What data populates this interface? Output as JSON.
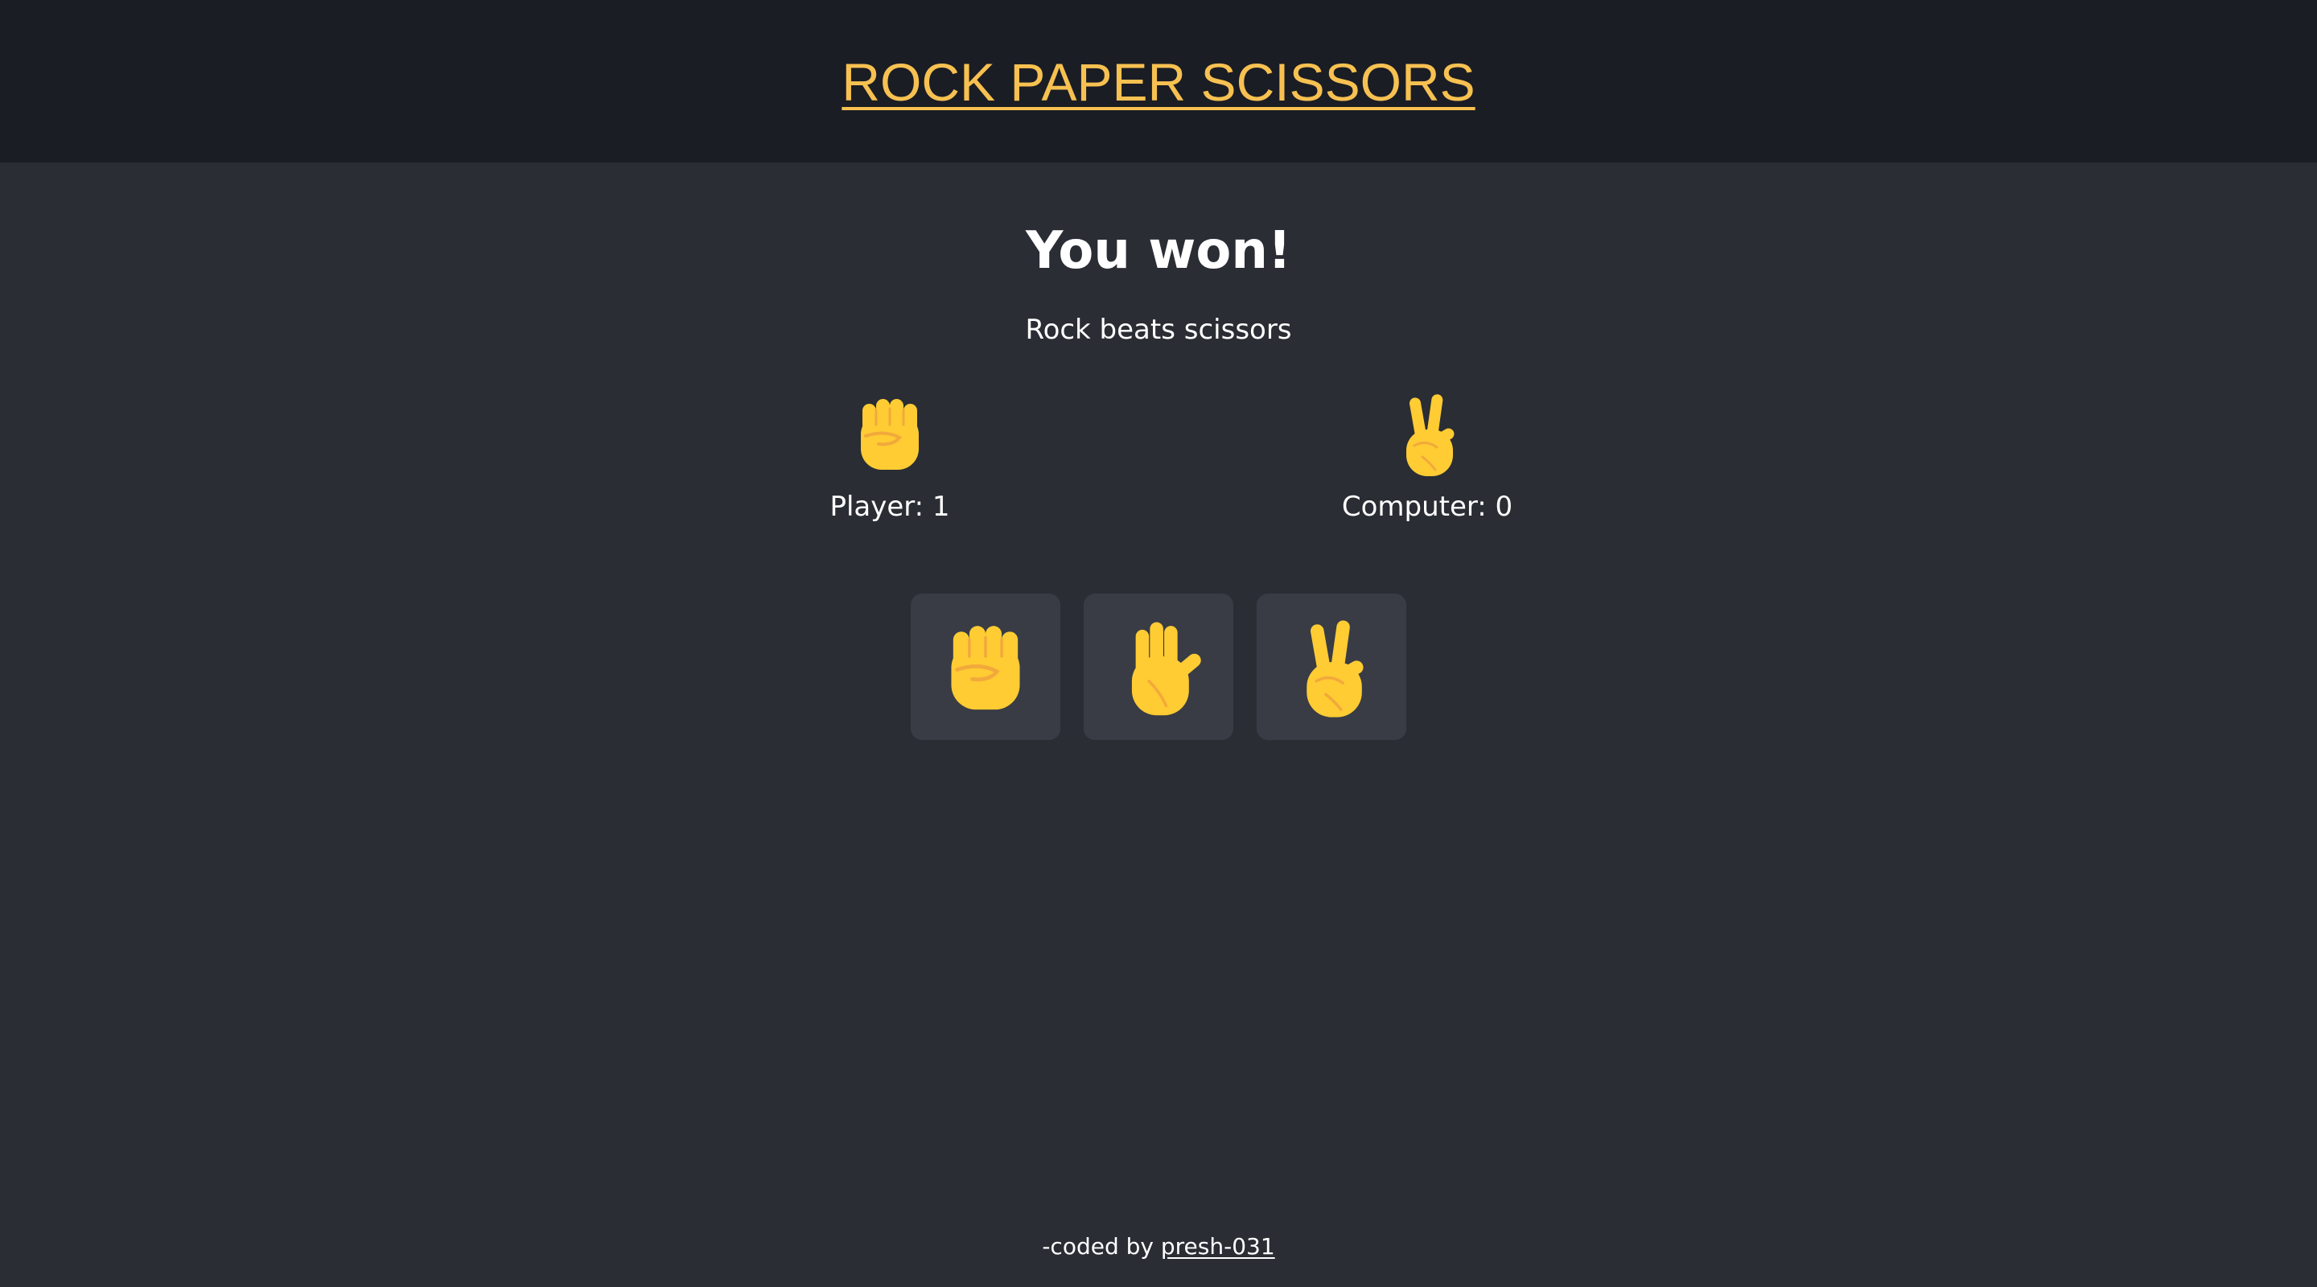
{
  "header": {
    "title": "ROCK PAPER SCISSORS"
  },
  "result": {
    "heading": "You won!",
    "detail": "Rock beats scissors"
  },
  "player": {
    "label": "Player: 1",
    "hand_icon": "rock-fist-icon"
  },
  "computer": {
    "label": "Computer: 0",
    "hand_icon": "scissors-victory-hand-icon"
  },
  "choices": [
    {
      "name": "rock",
      "icon": "rock-fist-icon"
    },
    {
      "name": "paper",
      "icon": "paper-hand-icon"
    },
    {
      "name": "scissors",
      "icon": "scissors-victory-hand-icon"
    }
  ],
  "footer": {
    "prefix": "-coded by",
    "author_link": "presh-031"
  },
  "colors": {
    "header_bg": "#1b1d24",
    "page_bg": "#2a2d34",
    "title": "#f7c151",
    "button_bg": "#393c44",
    "emoji_yellow": "#ffcc33",
    "emoji_shade": "#f2a93b"
  }
}
